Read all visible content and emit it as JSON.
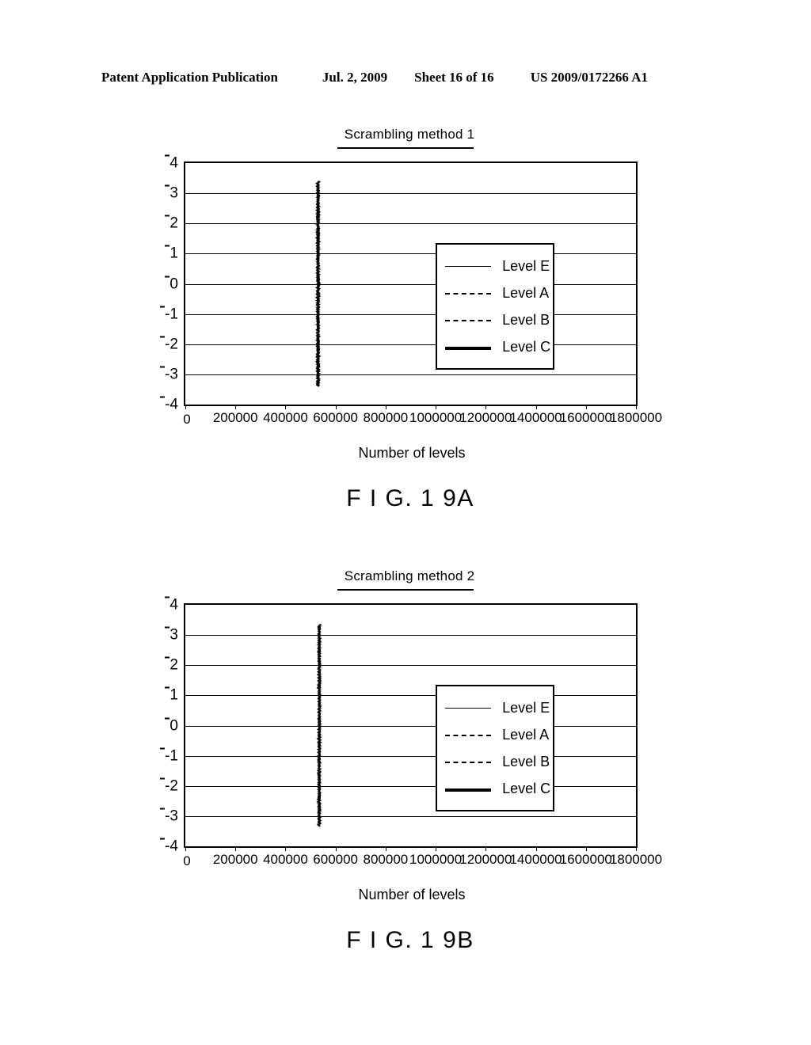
{
  "header": {
    "publication": "Patent Application Publication",
    "date": "Jul. 2, 2009",
    "sheet": "Sheet 16 of 16",
    "doc_number": "US 2009/0172266 A1"
  },
  "figures": [
    {
      "caption": "F I G. 1 9A",
      "chart_data": {
        "type": "line",
        "title": "Scrambling method 1",
        "xlabel": "Number of levels",
        "ylabel": "",
        "xlim": [
          0,
          1800000
        ],
        "ylim": [
          -4,
          4
        ],
        "xticks": [
          0,
          200000,
          400000,
          600000,
          800000,
          1000000,
          1200000,
          1400000,
          1600000,
          1800000
        ],
        "xtick_labels": [
          "0",
          "200000",
          "400000",
          "600000",
          "800000",
          "1000000",
          "1200000",
          "1400000",
          "1600000",
          "1800000"
        ],
        "yticks": [
          4,
          3,
          2,
          1,
          0,
          -1,
          -2,
          -3,
          -4
        ],
        "ytick_labels": [
          "4",
          "3",
          "2",
          "1",
          "0",
          "-1",
          "-2",
          "-3",
          "-4"
        ],
        "grid": true,
        "legend_position": "center-right",
        "series": [
          {
            "name": "Level E",
            "style": "solid-thin",
            "x_range": [
              520000,
              540000
            ],
            "y_range": [
              -3.4,
              3.4
            ],
            "values": [
              -3.4,
              -2.5,
              -1.6,
              -0.8,
              0.0,
              0.8,
              1.6,
              2.5,
              3.4
            ]
          },
          {
            "name": "Level A",
            "style": "dash-small",
            "x_range": [
              522000,
              538000
            ],
            "y_range": [
              -3.3,
              3.3
            ],
            "values": [
              -3.3,
              -2.4,
              -1.5,
              -0.7,
              0.1,
              0.9,
              1.7,
              2.5,
              3.3
            ]
          },
          {
            "name": "Level B",
            "style": "dash-large",
            "x_range": [
              524000,
              536000
            ],
            "y_range": [
              -3.3,
              3.3
            ],
            "values": [
              -3.3,
              -2.4,
              -1.5,
              -0.7,
              0.1,
              0.9,
              1.7,
              2.5,
              3.3
            ]
          },
          {
            "name": "Level C",
            "style": "solid-thick",
            "x_range": [
              526000,
              534000
            ],
            "y_range": [
              -3.4,
              3.4
            ],
            "values": [
              -3.4,
              -2.5,
              -1.6,
              -0.8,
              0.0,
              0.8,
              1.6,
              2.5,
              3.4
            ]
          }
        ]
      }
    },
    {
      "caption": "F I G. 1 9B",
      "chart_data": {
        "type": "line",
        "title": "Scrambling method 2",
        "xlabel": "Number of levels",
        "ylabel": "",
        "xlim": [
          0,
          1800000
        ],
        "ylim": [
          -4,
          4
        ],
        "xticks": [
          0,
          200000,
          400000,
          600000,
          800000,
          1000000,
          1200000,
          1400000,
          1600000,
          1800000
        ],
        "xtick_labels": [
          "0",
          "200000",
          "400000",
          "600000",
          "800000",
          "1000000",
          "1200000",
          "1400000",
          "1600000",
          "1800000"
        ],
        "yticks": [
          4,
          3,
          2,
          1,
          0,
          -1,
          -2,
          -3,
          -4
        ],
        "ytick_labels": [
          "4",
          "3",
          "2",
          "1",
          "0",
          "-1",
          "-2",
          "-3",
          "-4"
        ],
        "grid": true,
        "legend_position": "center-right",
        "series": [
          {
            "name": "Level E",
            "style": "solid-thin",
            "x_range": [
              528000,
              542000
            ],
            "y_range": [
              -3.3,
              3.3
            ],
            "values": [
              -3.3,
              -2.4,
              -1.5,
              -0.7,
              0.1,
              0.9,
              1.7,
              2.5,
              3.3
            ]
          },
          {
            "name": "Level A",
            "style": "dash-small",
            "x_range": [
              529000,
              541000
            ],
            "y_range": [
              -3.3,
              3.3
            ],
            "values": [
              -3.3,
              -2.4,
              -1.5,
              -0.7,
              0.1,
              0.9,
              1.7,
              2.5,
              3.3
            ]
          },
          {
            "name": "Level B",
            "style": "dash-large",
            "x_range": [
              530000,
              540000
            ],
            "y_range": [
              -3.3,
              3.3
            ],
            "values": [
              -3.3,
              -2.4,
              -1.5,
              -0.7,
              0.1,
              0.9,
              1.7,
              2.5,
              3.3
            ]
          },
          {
            "name": "Level C",
            "style": "solid-thick",
            "x_range": [
              531000,
              539000
            ],
            "y_range": [
              -3.35,
              3.35
            ],
            "values": [
              -3.35,
              -2.45,
              -1.55,
              -0.75,
              0.05,
              0.85,
              1.65,
              2.5,
              3.35
            ]
          }
        ]
      }
    }
  ],
  "colors": {
    "ink": "#000000",
    "page": "#ffffff"
  }
}
